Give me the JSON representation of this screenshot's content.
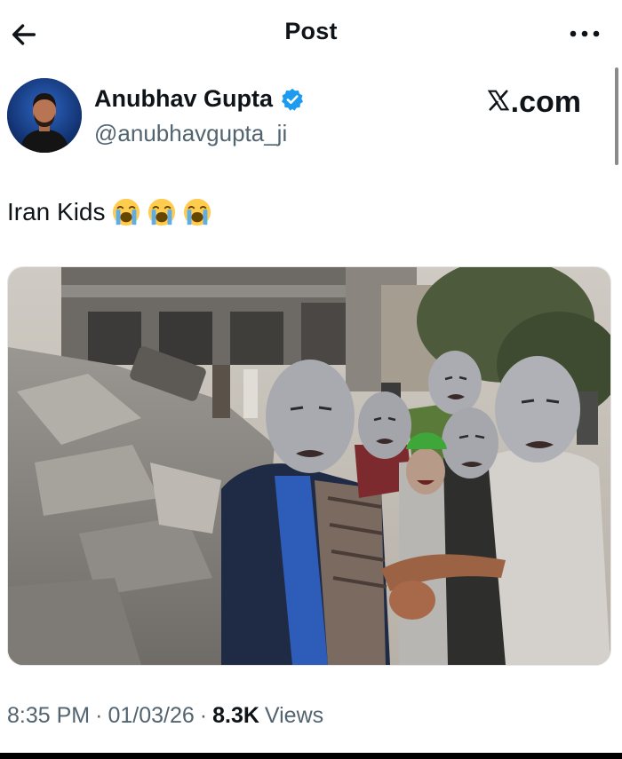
{
  "header": {
    "title": "Post",
    "back_icon": "arrow-left-icon",
    "more_icon": "more-horizontal-icon"
  },
  "author": {
    "name": "Anubhav Gupta",
    "handle": "@anubhavgupta_ji",
    "verified": true,
    "verified_color": "#1d9bf0"
  },
  "source": {
    "logo_letter": "X",
    "logo_text": ".com"
  },
  "post": {
    "text": "Iran Kids",
    "emojis": [
      "loudly-crying-face",
      "loudly-crying-face",
      "loudly-crying-face"
    ]
  },
  "media": {
    "icon": "photo-image"
  },
  "meta": {
    "time": "8:35 PM",
    "separator": "·",
    "date": "01/03/26",
    "views_count": "8.3K",
    "views_label": "Views"
  },
  "colors": {
    "text_primary": "#0f1419",
    "text_secondary": "#536471",
    "accent": "#1d9bf0"
  }
}
